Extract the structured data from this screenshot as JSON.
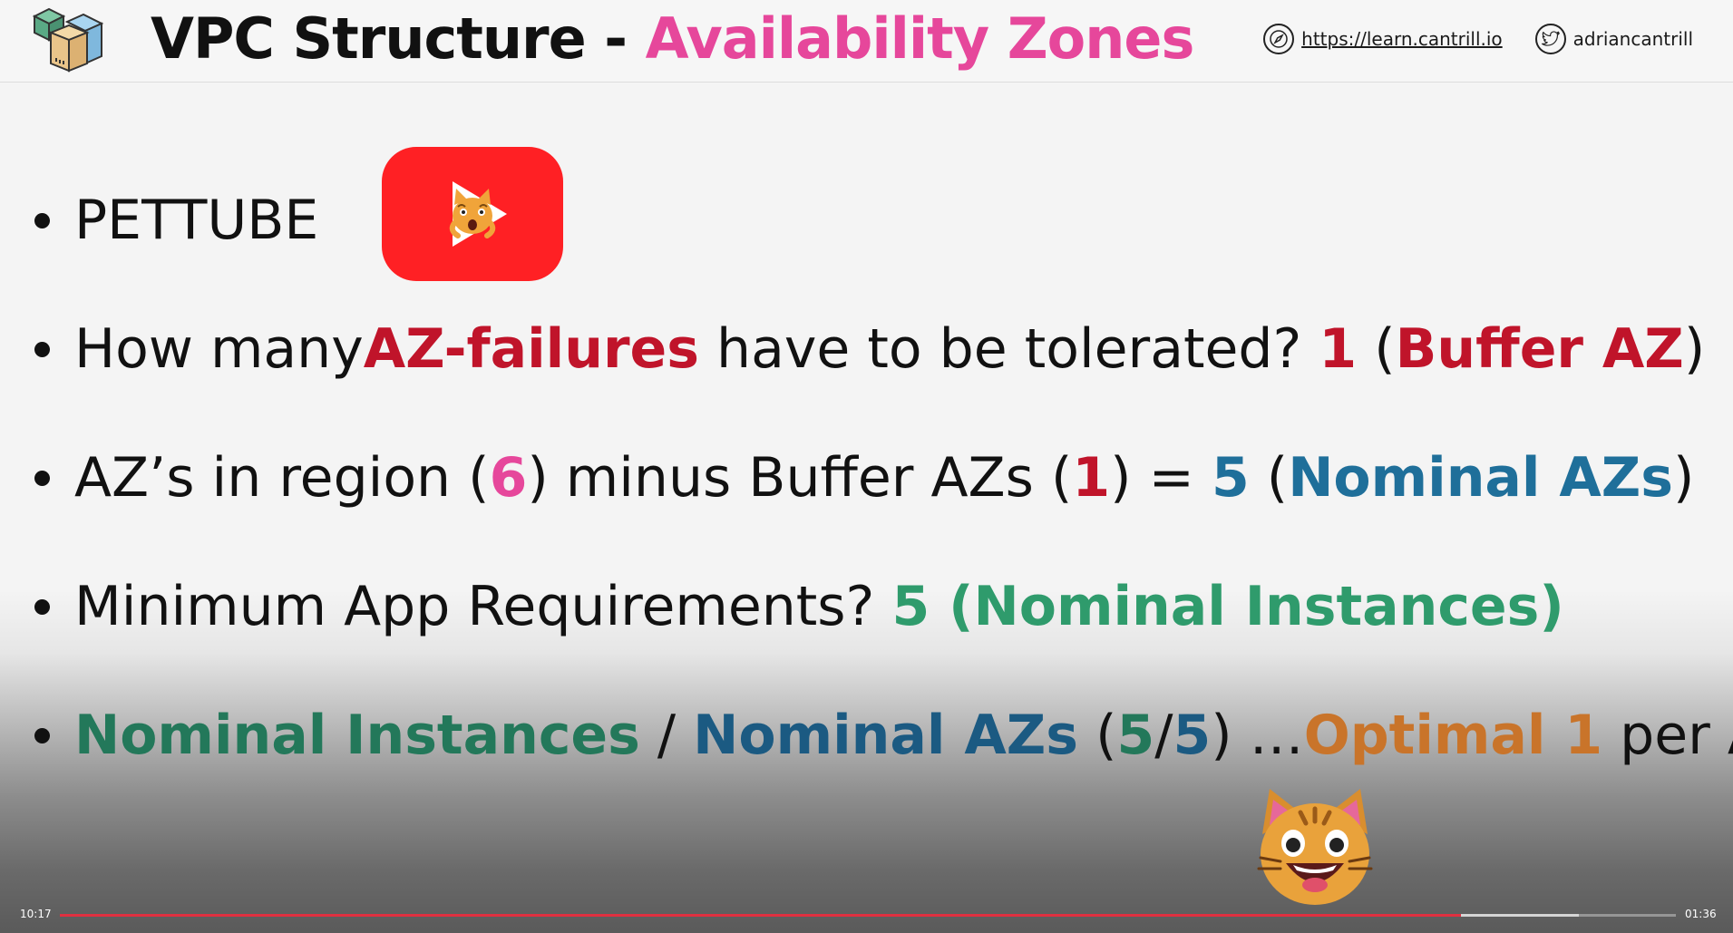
{
  "header": {
    "title_main": "VPC Structure - ",
    "title_accent": "Availability Zones",
    "website_url": "https://learn.cantrill.io",
    "twitter_handle": "adriancantrill"
  },
  "bullets": {
    "b1": {
      "text": "PETTUBE"
    },
    "b2": {
      "p1": "How many ",
      "p2": "AZ-failures",
      "p3": " have to be tolerated? ",
      "p4": "1",
      "p5": " (",
      "p6": "Buffer AZ",
      "p7": ")"
    },
    "b3": {
      "p1": "AZ’s in region (",
      "p2": "6",
      "p3": ") minus Buffer AZs (",
      "p4": "1",
      "p5": ") = ",
      "p6": "5",
      "p7": " (",
      "p8": "Nominal AZs",
      "p9": ")"
    },
    "b4": {
      "p1": "Minimum App Requirements? ",
      "p2": "5 (Nominal Instances)"
    },
    "b5": {
      "p1": "Nominal Instances",
      "p2": " / ",
      "p3": "Nominal AZs",
      "p4": " (",
      "p5": "5",
      "p6": "/",
      "p7": "5",
      "p8": ") …",
      "p9": "Optimal 1",
      "p10": " per AZ"
    }
  },
  "player": {
    "elapsed": "10:17",
    "remaining": "01:36",
    "played_fraction": 0.867,
    "buffered_fraction": 0.94
  },
  "colors": {
    "accent_pink": "#e6479b",
    "red": "#c0142a",
    "blue": "#1f6f9a",
    "green": "#2f9b6c",
    "orange": "#c9742a",
    "youtube_red": "#ff2024"
  },
  "icons": {
    "logo": "stacked-boxes-icon",
    "web": "compass-icon",
    "twitter": "twitter-bird-icon",
    "pettube": "youtube-play-cat-icon",
    "cat": "grinning-cat-icon"
  }
}
